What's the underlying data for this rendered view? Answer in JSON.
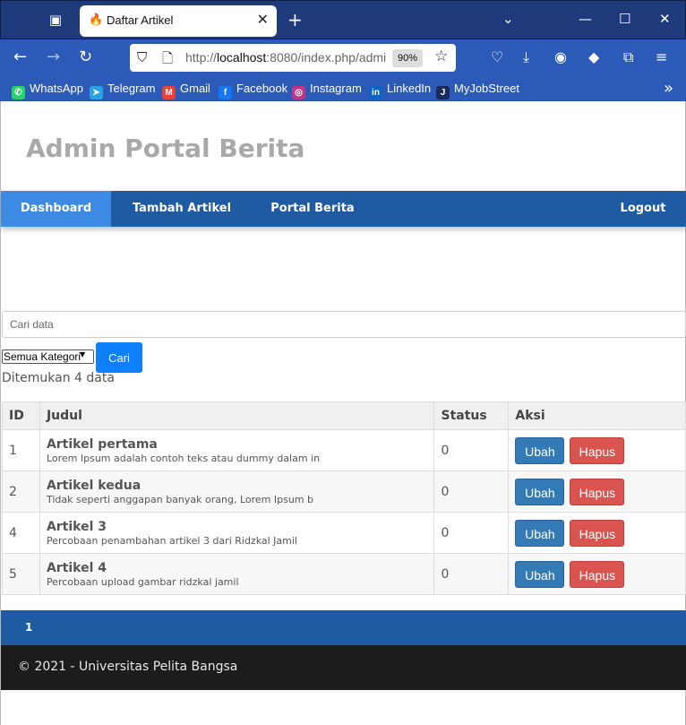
{
  "browser": {
    "tab_title": "Daftar Artikel",
    "url_prefix": "http://",
    "url_host": "localhost",
    "url_rest": ":8080/index.php/admi",
    "zoom": "90%",
    "bookmarks": [
      {
        "label": "WhatsApp",
        "color": "#25d366",
        "glyph": "✆"
      },
      {
        "label": "Telegram",
        "color": "#2aa3e0",
        "glyph": "➤"
      },
      {
        "label": "Gmail",
        "color": "#ea4335",
        "glyph": "M"
      },
      {
        "label": "Facebook",
        "color": "#1877f2",
        "glyph": "f"
      },
      {
        "label": "Instagram",
        "color": "#c13584",
        "glyph": "◎"
      },
      {
        "label": "LinkedIn",
        "color": "#0a66c2",
        "glyph": "in"
      },
      {
        "label": "MyJobStreet",
        "color": "#1b2a5c",
        "glyph": "J"
      }
    ]
  },
  "site": {
    "title": "Admin Portal Berita",
    "menu": {
      "dashboard": "Dashboard",
      "tambah": "Tambah Artikel",
      "portal": "Portal Berita",
      "logout": "Logout"
    }
  },
  "search": {
    "placeholder": "Cari data",
    "kategori": "Semua Kategori",
    "button": "Cari",
    "result_text": "Ditemukan 4 data"
  },
  "table": {
    "headers": [
      "ID",
      "Judul",
      "Status",
      "Aksi"
    ],
    "rows": [
      {
        "id": "1",
        "judul": "Artikel pertama",
        "ringkas": "Lorem Ipsum adalah contoh teks atau dummy dalam in",
        "status": "0"
      },
      {
        "id": "2",
        "judul": "Artikel kedua",
        "ringkas": "Tidak seperti anggapan banyak orang, Lorem Ipsum b",
        "status": "0"
      },
      {
        "id": "4",
        "judul": "Artikel 3",
        "ringkas": "Percobaan penambahan artikel 3 dari Ridzkal Jamil",
        "status": "0"
      },
      {
        "id": "5",
        "judul": "Artikel 4",
        "ringkas": "Percobaan upload gambar ridzkal jamil",
        "status": "0"
      }
    ],
    "edit_label": "Ubah",
    "delete_label": "Hapus"
  },
  "pagination": {
    "current": "1"
  },
  "footer": {
    "text": "© 2021 - Universitas Pelita Bangsa"
  }
}
